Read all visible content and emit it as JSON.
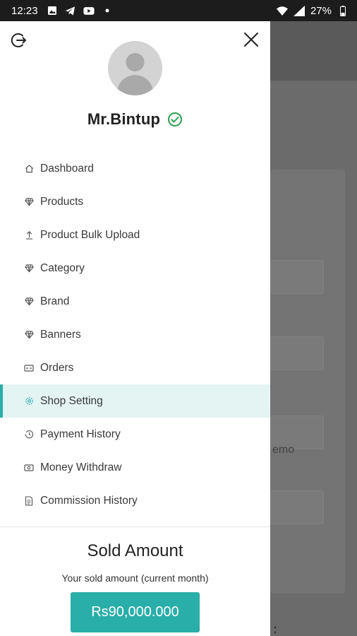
{
  "statusbar": {
    "time": "12:23",
    "battery": "27%",
    "left_icons": [
      "image-icon",
      "telegram-icon",
      "youtube-icon",
      "dot-icon"
    ],
    "right_icons": [
      "wifi-icon",
      "signal-icon",
      "battery-icon"
    ]
  },
  "drawer": {
    "user": {
      "name": "Mr.Bintup",
      "verified": true
    },
    "menu": [
      {
        "label": "Dashboard",
        "icon": "home-icon"
      },
      {
        "label": "Products",
        "icon": "diamond-icon"
      },
      {
        "label": "Product Bulk Upload",
        "icon": "upload-icon"
      },
      {
        "label": "Category",
        "icon": "diamond-icon"
      },
      {
        "label": "Brand",
        "icon": "diamond-icon"
      },
      {
        "label": "Banners",
        "icon": "diamond-icon"
      },
      {
        "label": "Orders",
        "icon": "card-icon"
      },
      {
        "label": "Shop Setting",
        "icon": "gear-icon",
        "active": true
      },
      {
        "label": "Payment History",
        "icon": "history-icon"
      },
      {
        "label": "Money Withdraw",
        "icon": "money-icon"
      },
      {
        "label": "Commission History",
        "icon": "document-icon"
      }
    ],
    "sold": {
      "title": "Sold Amount",
      "subtitle": "Your sold amount (current month)",
      "amount": "Rs90,000.000"
    }
  },
  "background": {
    "visible_text": "emo",
    "menu_glyph": "⋮"
  },
  "colors": {
    "accent": "#2aaea9",
    "active_bg": "#e3f4f3",
    "verified": "#2e9e4f",
    "overlay": "#6b6b6b"
  }
}
